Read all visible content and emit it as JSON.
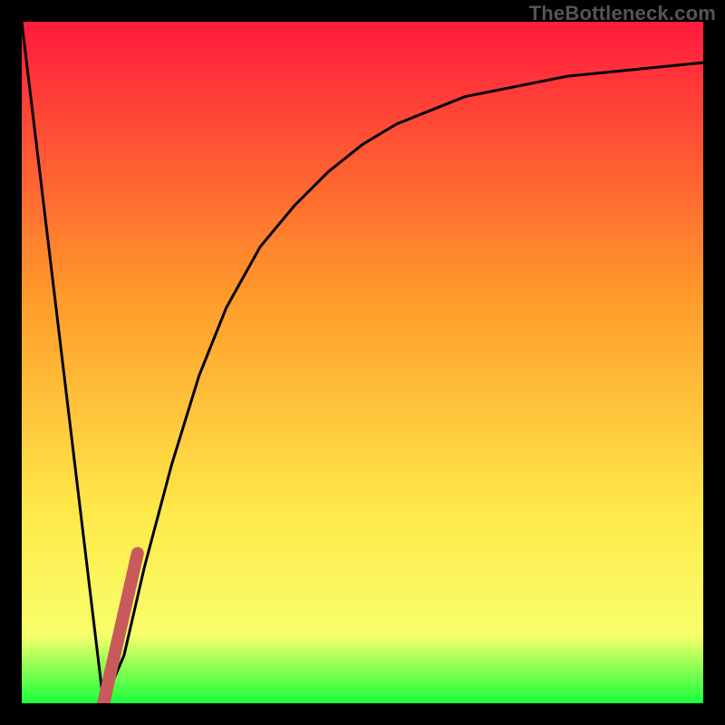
{
  "watermark": "TheBottleneck.com",
  "colors": {
    "gradient_top": "#ff1a3d",
    "gradient_mid1": "#ff9a2a",
    "gradient_mid2": "#ffe94a",
    "gradient_mid3": "#f7ff6a",
    "gradient_bottom": "#18ff3a",
    "curve": "#000000",
    "highlight": "#c95a5c",
    "background": "#000000"
  },
  "chart_data": {
    "type": "line",
    "title": "",
    "xlabel": "",
    "ylabel": "",
    "xlim": [
      0,
      100
    ],
    "ylim": [
      0,
      100
    ],
    "legend": false,
    "grid": false,
    "series": [
      {
        "name": "bottleneck_curve",
        "x": [
          0,
          12,
          15,
          18,
          22,
          26,
          30,
          35,
          40,
          45,
          50,
          55,
          60,
          65,
          70,
          75,
          80,
          85,
          90,
          95,
          100
        ],
        "values": [
          100,
          0,
          7,
          20,
          35,
          48,
          58,
          67,
          73,
          78,
          82,
          85,
          87,
          89,
          90,
          91,
          92,
          92.5,
          93,
          93.5,
          94
        ]
      }
    ],
    "highlight_band": {
      "name": "optimal_range",
      "x": [
        12,
        17
      ],
      "values": [
        0,
        22
      ]
    }
  }
}
